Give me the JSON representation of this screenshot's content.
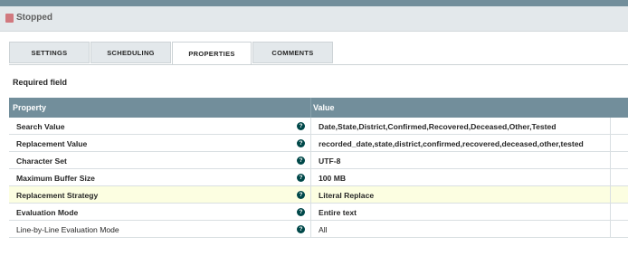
{
  "status": {
    "text": "Stopped",
    "icon": "stop-square-icon",
    "icon_color": "#d1797f"
  },
  "tabs": [
    {
      "label": "SETTINGS",
      "active": false
    },
    {
      "label": "SCHEDULING",
      "active": false
    },
    {
      "label": "PROPERTIES",
      "active": true
    },
    {
      "label": "COMMENTS",
      "active": false
    }
  ],
  "required_label": "Required field",
  "table": {
    "headers": {
      "property": "Property",
      "value": "Value"
    },
    "header_color": "#728e9b",
    "rows": [
      {
        "name": "Search Value",
        "value": "Date,State,District,Confirmed,Recovered,Deceased,Other,Tested",
        "help": "?"
      },
      {
        "name": "Replacement Value",
        "value": "recorded_date,state,district,confirmed,recovered,deceased,other,tested",
        "help": "?"
      },
      {
        "name": "Character Set",
        "value": "UTF-8",
        "help": "?"
      },
      {
        "name": "Maximum Buffer Size",
        "value": "100 MB",
        "help": "?"
      },
      {
        "name": "Replacement Strategy",
        "value": "Literal Replace",
        "help": "?",
        "highlighted": true
      },
      {
        "name": "Evaluation Mode",
        "value": "Entire text",
        "help": "?"
      },
      {
        "name": "Line-by-Line Evaluation Mode",
        "value": "All",
        "help": "?",
        "optional": true
      }
    ]
  }
}
